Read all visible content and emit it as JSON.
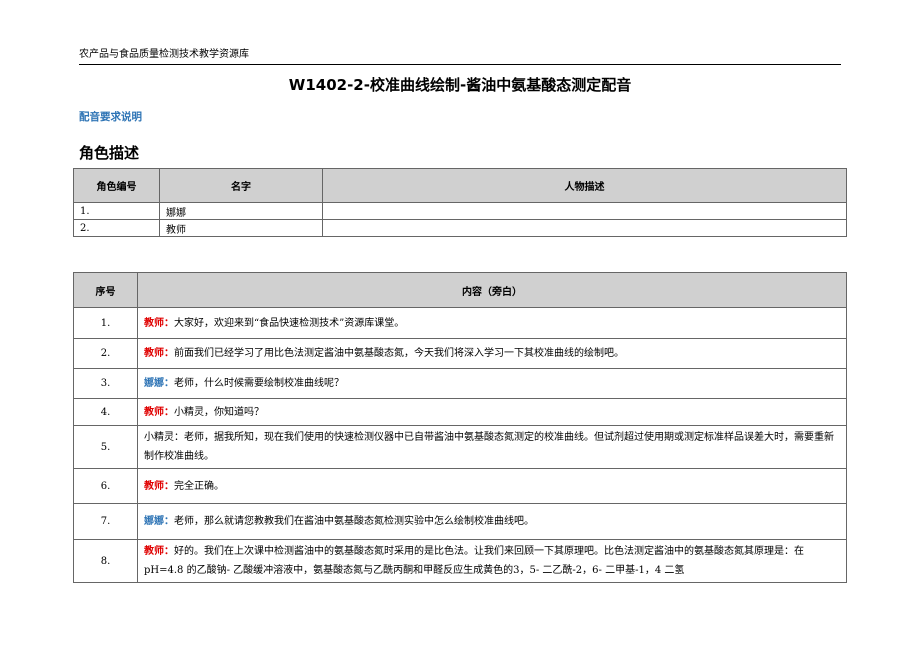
{
  "header": {
    "text": "农产品与食品质量检测技术教学资源库"
  },
  "title": "W1402-2-校准曲线绘制-酱油中氨基酸态测定配音",
  "dubbing_heading": "配音要求说明",
  "roles_heading": "角色描述",
  "roles_table": {
    "headers": [
      "角色编号",
      "名字",
      "人物描述"
    ],
    "rows": [
      {
        "num": "1.",
        "name": "娜娜",
        "desc": ""
      },
      {
        "num": "2.",
        "name": "教师",
        "desc": ""
      }
    ]
  },
  "lines_table": {
    "headers": [
      "序号",
      "内容（旁白）"
    ],
    "rows": [
      {
        "num": "1.",
        "speaker": "教师：",
        "speaker_color": "#e00000",
        "text": "大家好，欢迎来到“食品快速检测技术”资源库课堂。"
      },
      {
        "num": "2.",
        "speaker": "教师：",
        "speaker_color": "#e00000",
        "text": "前面我们已经学习了用比色法测定酱油中氨基酸态氮，今天我们将深入学习一下其校准曲线的绘制吧。"
      },
      {
        "num": "3.",
        "speaker": "娜娜：",
        "speaker_color": "#2e74b5",
        "text": "老师，什么时候需要绘制校准曲线呢？"
      },
      {
        "num": "4.",
        "speaker": "教师：",
        "speaker_color": "#e00000",
        "text": "小精灵，你知道吗？"
      },
      {
        "num": "5.",
        "speaker": "",
        "speaker_color": "",
        "text": "小精灵：老师，据我所知，现在我们使用的快速检测仪器中已自带酱油中氨基酸态氮测定的校准曲线。但试剂超过使用期或测定标准样品误差大时，需要重新制作校准曲线。"
      },
      {
        "num": "6.",
        "speaker": "教师：",
        "speaker_color": "#e00000",
        "text": "完全正确。"
      },
      {
        "num": "7.",
        "speaker": "娜娜：",
        "speaker_color": "#2e74b5",
        "text": "老师，那么就请您教教我们在酱油中氨基酸态氮检测实验中怎么绘制校准曲线吧。"
      },
      {
        "num": "8.",
        "speaker": "教师：",
        "speaker_color": "#e00000",
        "text": "好的。我们在上次课中检测酱油中的氨基酸态氮时采用的是比色法。让我们来回顾一下其原理吧。比色法测定酱油中的氨基酸态氮其原理是：在pH=4.8 的乙酸钠- 乙酸缓冲溶液中，氨基酸态氮与乙酰丙酮和甲醛反应生成黄色的3，5- 二乙酰-2，6- 二甲基-1，4 二氢"
      }
    ]
  }
}
